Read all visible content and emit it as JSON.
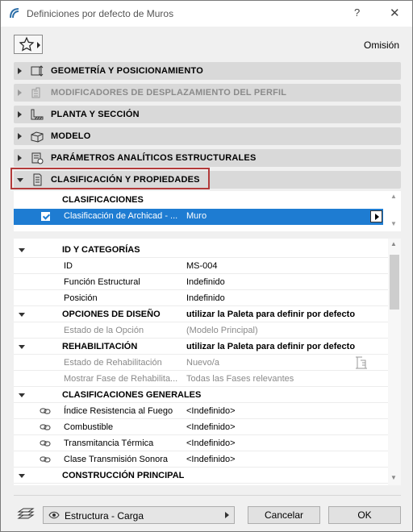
{
  "window": {
    "title": "Definiciones por defecto de Muros",
    "help": "?",
    "close": "✕"
  },
  "toolbar": {
    "mode_label": "Omisión"
  },
  "panels": [
    {
      "label": "GEOMETRÍA Y POSICIONAMIENTO",
      "icon": "geometry-icon"
    },
    {
      "label": "MODIFICADORES DE DESPLAZAMIENTO DEL PERFIL",
      "icon": "profile-offset-icon",
      "disabled": true
    },
    {
      "label": "PLANTA Y SECCIÓN",
      "icon": "floor-plan-section-icon"
    },
    {
      "label": "MODELO",
      "icon": "model-icon"
    },
    {
      "label": "PARÁMETROS ANALÍTICOS ESTRUCTURALES",
      "icon": "structural-analytic-icon"
    },
    {
      "label": "CLASIFICACIÓN Y PROPIEDADES",
      "icon": "classification-icon",
      "expanded": true
    }
  ],
  "classifications": {
    "header": "CLASIFICACIONES",
    "row": {
      "name": "Clasificación de Archicad - ...",
      "value": "Muro",
      "checked": true
    }
  },
  "properties": {
    "id_group": {
      "label": "ID Y CATEGORÍAS",
      "rows": [
        {
          "key": "ID",
          "value": "MS-004"
        },
        {
          "key": "Función Estructural",
          "value": "Indefinido"
        },
        {
          "key": "Posición",
          "value": "Indefinido"
        }
      ]
    },
    "design_group": {
      "label": "OPCIONES DE DISEÑO",
      "value": "utilizar la Paleta para definir por defecto",
      "rows": [
        {
          "key": "Estado de la Opción",
          "value": "(Modelo Principal)"
        }
      ]
    },
    "renovation_group": {
      "label": "REHABILITACIÓN",
      "value": "utilizar la Paleta para definir por defecto",
      "rows": [
        {
          "key": "Estado de Rehabilitación",
          "value": "Nuevo/a"
        },
        {
          "key": "Mostrar Fase de Rehabilita...",
          "value": "Todas las Fases relevantes"
        }
      ]
    },
    "general_group": {
      "label": "CLASIFICACIONES GENERALES",
      "rows": [
        {
          "key": "Índice Resistencia al Fuego",
          "value": "<Indefinido>"
        },
        {
          "key": "Combustible",
          "value": "<Indefinido>"
        },
        {
          "key": "Transmitancia Térmica",
          "value": "<Indefinido>"
        },
        {
          "key": "Clase Transmisión Sonora",
          "value": "<Indefinido>"
        }
      ]
    },
    "construction_group": {
      "label": "CONSTRUCCIÓN PRINCIPAL"
    }
  },
  "footer": {
    "layer_value": "Estructura - Carga",
    "cancel_label": "Cancelar",
    "ok_label": "OK"
  }
}
